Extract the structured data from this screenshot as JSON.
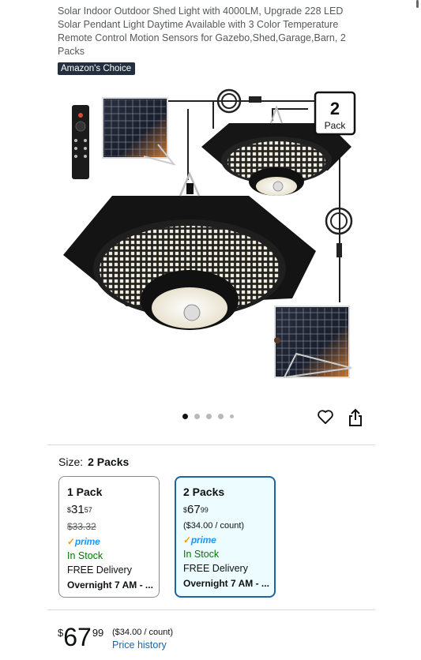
{
  "product": {
    "title": "Solar Indoor Outdoor Shed Light with 4000LM, Upgrade 228 LED Solar Pendant Light Daytime Available with 3 Color Temperature Remote Control Motion Sensors for Gazebo,Shed,Garage,Barn, 2 Packs",
    "badge": "Amazon's Choice",
    "image_badge": {
      "number": "2",
      "label": "Pack"
    }
  },
  "gallery": {
    "dot_count": 5,
    "active_index": 0
  },
  "size": {
    "label": "Size:",
    "value": "2 Packs",
    "options": [
      {
        "name": "1 Pack",
        "price_symbol": "$",
        "price_whole": "31",
        "price_fraction": "57",
        "list_price": "$33.32",
        "prime": "prime",
        "stock": "In Stock",
        "delivery": "FREE Delivery",
        "delivery_time": "Overnight 7 AM - ...",
        "selected": false
      },
      {
        "name": "2 Packs",
        "price_symbol": "$",
        "price_whole": "67",
        "price_fraction": "99",
        "unit_price": "($34.00 / count)",
        "prime": "prime",
        "stock": "In Stock",
        "delivery": "FREE Delivery",
        "delivery_time": "Overnight 7 AM - ...",
        "selected": true
      }
    ]
  },
  "buybox": {
    "price_symbol": "$",
    "price_whole": "67",
    "price_fraction": "99",
    "unit_price": "($34.00 / count)",
    "price_history": "Price history"
  },
  "colors": {
    "selected_border": "#2162a1",
    "selected_bg": "#edfdff",
    "in_stock": "#007600",
    "prime": "#1a98ff",
    "link": "#2162a1"
  }
}
